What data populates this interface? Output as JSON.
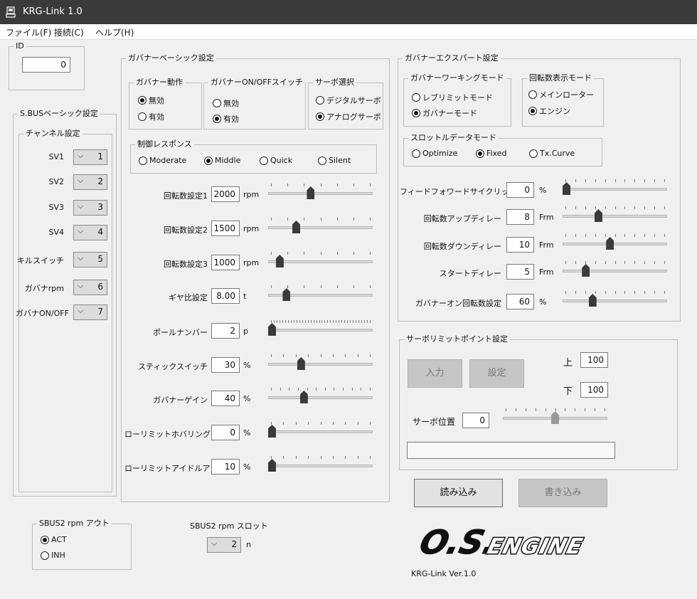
{
  "window": {
    "title": "KRG-Link 1.0"
  },
  "menu": {
    "file": "ファイル(F)",
    "connect": "接続(C)",
    "help": "ヘルプ(H)"
  },
  "id_group": {
    "title": "ID",
    "value": "0"
  },
  "sbus_basic": {
    "title": "S.BUSベーシック設定",
    "channel_title": "チャンネル設定",
    "rows": [
      {
        "label": "SV1",
        "value": "1"
      },
      {
        "label": "SV2",
        "value": "2"
      },
      {
        "label": "SV3",
        "value": "3"
      },
      {
        "label": "SV4",
        "value": "4"
      },
      {
        "label": "キルスイッチ",
        "value": "5"
      },
      {
        "label": "ガバナrpm",
        "value": "6"
      },
      {
        "label": "ガバナON/OFF",
        "value": "7"
      }
    ]
  },
  "gov_basic": {
    "title": "ガバナーベーシック設定",
    "gov_action": {
      "title": "ガバナー動作",
      "opt_off": "無効",
      "opt_on": "有効",
      "selected": "無効"
    },
    "gov_switch": {
      "title": "ガバナーON/OFFスイッチ",
      "opt_off": "無効",
      "opt_on": "有効",
      "selected": "有効"
    },
    "servo_select": {
      "title": "サーボ選択",
      "opt_digital": "デジタルサーボ",
      "opt_analog": "アナログサーボ",
      "selected": "アナログサーボ"
    },
    "response": {
      "title": "制御レスポンス",
      "options": [
        "Moderate",
        "Middle",
        "Quick",
        "Silent"
      ],
      "selected": "Middle"
    },
    "params": [
      {
        "label": "回転数設定1",
        "value": "2000",
        "unit": "rpm",
        "level": 0.4
      },
      {
        "label": "回転数設定2",
        "value": "1500",
        "unit": "rpm",
        "level": 0.25
      },
      {
        "label": "回転数設定3",
        "value": "1000",
        "unit": "rpm",
        "level": 0.08
      },
      {
        "label": "ギヤ比設定",
        "value": "8.00",
        "unit": "t",
        "level": 0.15
      },
      {
        "label": "ポールナンバー",
        "value": "2",
        "unit": "p",
        "level": 0.0
      },
      {
        "label": "スティックスイッチ",
        "value": "30",
        "unit": "%",
        "level": 0.3
      },
      {
        "label": "ガバナーゲイン",
        "value": "40",
        "unit": "%",
        "level": 0.33
      },
      {
        "label": "ローリミットホバリング",
        "value": "0",
        "unit": "%",
        "level": 0.0
      },
      {
        "label": "ローリミットアイドルアップ",
        "value": "10",
        "unit": "%",
        "level": 0.0
      }
    ]
  },
  "gov_expert": {
    "title": "ガバナーエクスパート設定",
    "working_mode": {
      "title": "ガバナーワーキングモード",
      "opt_rev": "レブリミットモード",
      "opt_gov": "ガバナーモード",
      "selected": "ガバナーモード"
    },
    "rpm_display": {
      "title": "回転数表示モード",
      "opt_main": "メインローター",
      "opt_engine": "エンジン",
      "selected": "エンジン"
    },
    "throttle_mode": {
      "title": "スロットルデータモード",
      "options": [
        "Optimize",
        "Fixed",
        "Tx.Curve"
      ],
      "selected": "Fixed"
    },
    "params": [
      {
        "label": "フィードフォワードサイクリック",
        "value": "0",
        "unit": "%",
        "level": 0.0
      },
      {
        "label": "回転数アップディレー",
        "value": "8",
        "unit": "Frm",
        "level": 0.33
      },
      {
        "label": "回転数ダウンディレー",
        "value": "10",
        "unit": "Frm",
        "level": 0.45
      },
      {
        "label": "スタートディレー",
        "value": "5",
        "unit": "Frm",
        "level": 0.2
      },
      {
        "label": "ガバナーオン回転数設定",
        "value": "60",
        "unit": "%",
        "level": 0.27
      }
    ]
  },
  "servo_limit": {
    "title": "サーボリミットポイント設定",
    "input_button": "入力",
    "set_button": "設定",
    "upper_label": "上",
    "upper_value": "100",
    "lower_label": "下",
    "lower_value": "100",
    "position_label": "サーボ位置",
    "position_value": "0",
    "position_level": 0.5
  },
  "actions": {
    "read": "読み込み",
    "write": "書き込み"
  },
  "sbus2_out": {
    "title": "SBUS2 rpm アウト",
    "opt_act": "ACT",
    "opt_inh": "INH",
    "selected": "ACT"
  },
  "sbus2_slot": {
    "title": "SBUS2 rpm スロット",
    "value": "2",
    "unit": "n"
  },
  "logo": {
    "brand": "O.S.ENGINE",
    "version": "KRG-Link  Ver.1.0"
  }
}
